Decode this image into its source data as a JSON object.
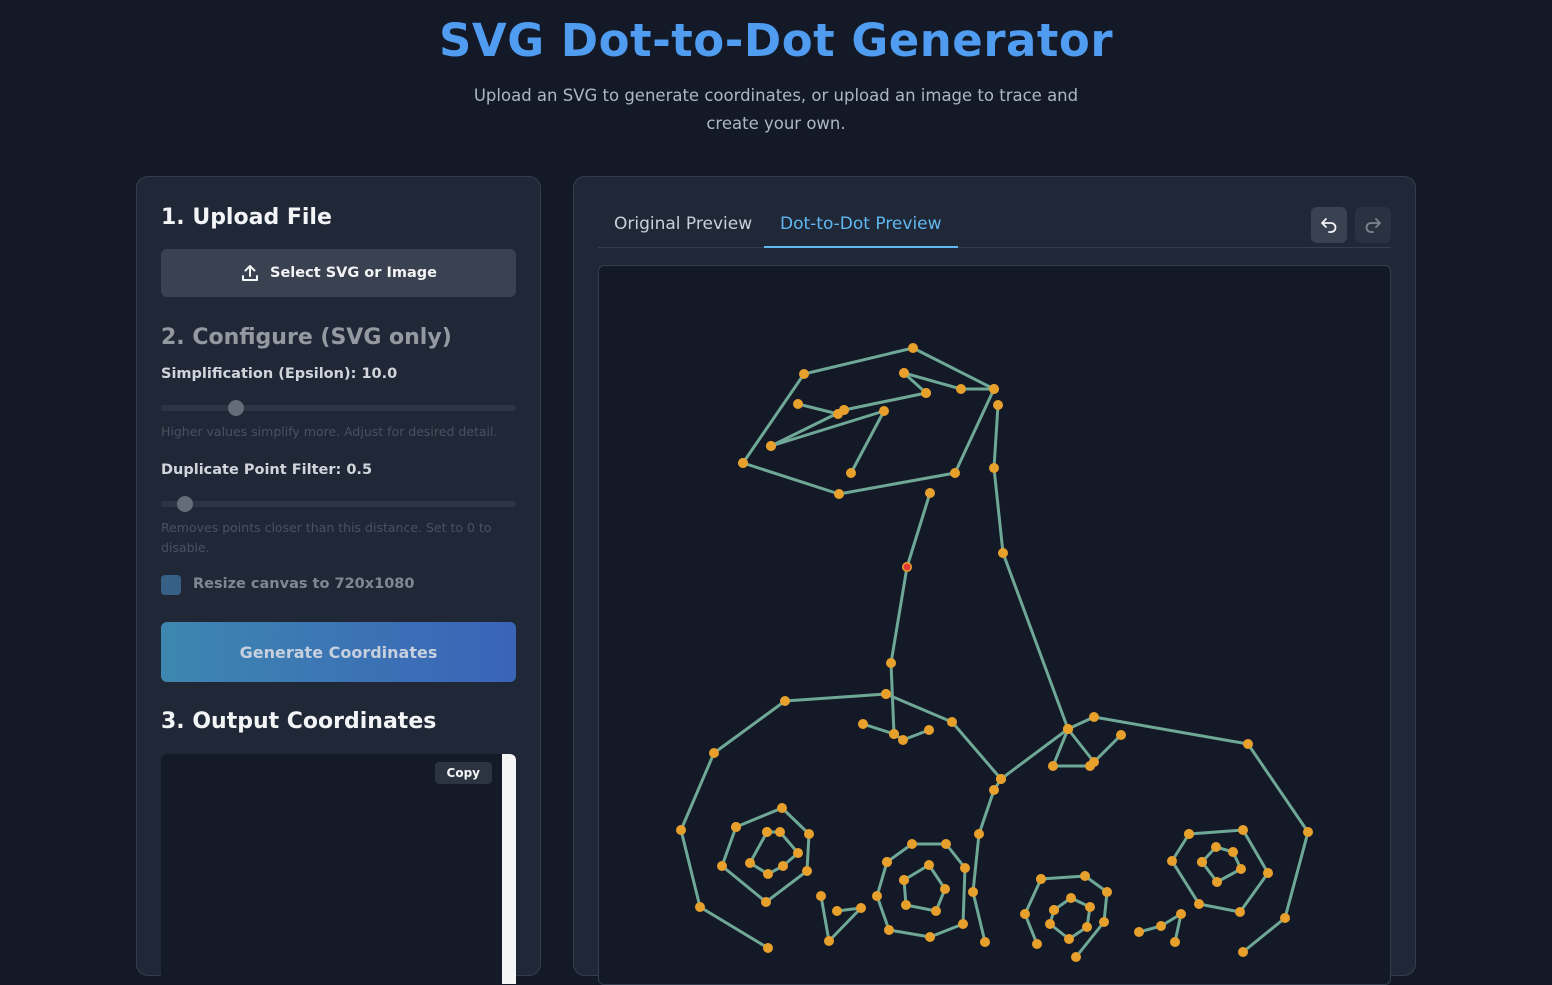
{
  "header": {
    "title": "SVG Dot-to-Dot Generator",
    "subtitle": "Upload an SVG to generate coordinates, or upload an image to trace and create your own."
  },
  "upload": {
    "heading": "1. Upload File",
    "button_label": "Select SVG or Image",
    "icon": "upload-icon"
  },
  "configure": {
    "heading": "2. Configure (SVG only)",
    "epsilon_label": "Simplification (Epsilon): 10.0",
    "epsilon_value": 10.0,
    "epsilon_hint": "Higher values simplify more. Adjust for desired detail.",
    "dup_label": "Duplicate Point Filter: 0.5",
    "dup_value": 0.5,
    "dup_hint": "Removes points closer than this distance. Set to 0 to disable.",
    "resize_label": "Resize canvas to 720x1080",
    "resize_checked": true,
    "generate_label": "Generate Coordinates"
  },
  "output": {
    "heading": "3. Output Coordinates",
    "copy_label": "Copy",
    "value": ""
  },
  "preview": {
    "tabs": [
      {
        "label": "Original Preview",
        "active": false
      },
      {
        "label": "Dot-to-Dot Preview",
        "active": true
      }
    ],
    "undo_icon": "undo-icon",
    "redo_icon": "redo-icon"
  },
  "colors": {
    "line": "#6fa896",
    "dot": "#e8a02c",
    "start_dot": "#e53935",
    "accent": "#5fb8f0"
  }
}
